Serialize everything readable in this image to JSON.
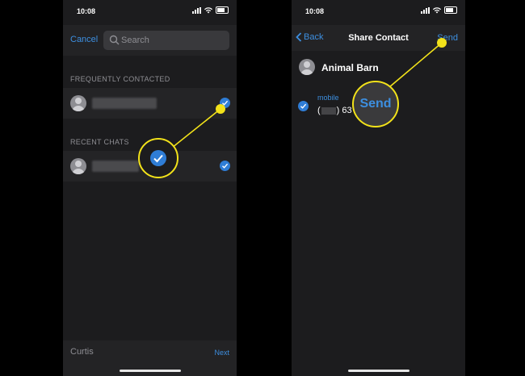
{
  "left_screen": {
    "status_time": "10:08",
    "cancel_label": "Cancel",
    "search_placeholder": "Search",
    "sections": {
      "frequent": "FREQUENTLY CONTACTED",
      "recent": "RECENT CHATS"
    },
    "contacts": [
      {
        "selected": true
      },
      {
        "selected": true
      }
    ],
    "bottom_name": "Curtis",
    "next_label": "Next"
  },
  "right_screen": {
    "status_time": "10:08",
    "back_label": "Back",
    "title": "Share Contact",
    "send_label": "Send",
    "contact_name": "Animal Barn",
    "phone_type": "mobile",
    "phone_prefix": "(",
    "phone_mid": ") 63"
  },
  "callouts": {
    "send_zoom_label": "Send"
  },
  "colors": {
    "accent_blue": "#3d8fe0",
    "check_blue": "#2f7dd6",
    "callout_yellow": "#f2e21a",
    "screen_bg": "#1c1c1e"
  },
  "icons": [
    "search-icon",
    "checkmark-icon",
    "chevron-left-icon",
    "person-avatar-icon",
    "wifi-icon",
    "signal-icon",
    "battery-icon"
  ]
}
